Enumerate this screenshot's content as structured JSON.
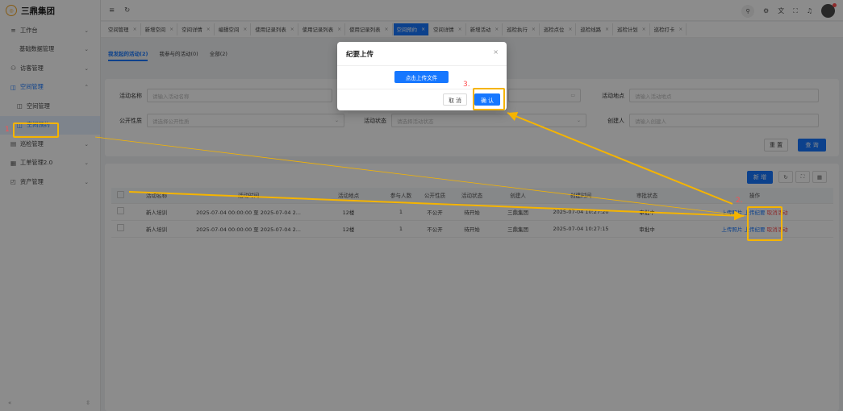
{
  "app": {
    "logo_text": "三鼎集团",
    "logo_glyph": "◎"
  },
  "sidebar": {
    "items": [
      {
        "label": "工作台",
        "icon": "≡"
      },
      {
        "label": "基础数据管理"
      },
      {
        "label": "访客管理",
        "icon": "⚇"
      },
      {
        "label": "空间管理",
        "icon": "◫"
      },
      {
        "label": "空间管理",
        "icon": "◫"
      },
      {
        "label": "空间预约",
        "icon": "◫"
      },
      {
        "label": "巡检管理",
        "icon": "▤"
      },
      {
        "label": "工单管理2.0",
        "icon": "▦"
      },
      {
        "label": "资产管理",
        "icon": "◰"
      }
    ],
    "collapse_glyph": "«",
    "bottom_glyph": "⇳"
  },
  "topbar": {
    "menu_glyph": "≡",
    "refresh_glyph": "↻",
    "right_icons": [
      "⚲",
      "⚙",
      "文",
      "⛶",
      "♫"
    ]
  },
  "tabs": [
    "空间管理",
    "新增空间",
    "空间详情",
    "编辑空间",
    "使用记录列表",
    "使用记录列表",
    "使用记录列表",
    "空间预约",
    "空间详情",
    "新增活动",
    "巡检执行",
    "巡检点位",
    "巡检线路",
    "巡检计划",
    "巡检打卡"
  ],
  "tab_close": "×",
  "subtabs": [
    "我发起的活动(2)",
    "我参与的活动(0)",
    "全部(2)"
  ],
  "form": {
    "fields": [
      {
        "label": "活动名称",
        "placeholder": "请输入活动名称"
      },
      {
        "label": "活动地点",
        "placeholder": "请输入活动地点"
      },
      {
        "label": "公开性质",
        "placeholder": "请选择公开性质"
      },
      {
        "label": "活动状态",
        "placeholder": "请选择活动状态"
      },
      {
        "label": "创建人",
        "placeholder": "请输入创建人"
      }
    ],
    "date_placeholder": "",
    "reset_label": "重 置",
    "search_label": "查 询"
  },
  "table": {
    "new_label": "新 增",
    "headers": [
      "活动名称",
      "活动时间",
      "活动地点",
      "参与人数",
      "公开性质",
      "活动状态",
      "创建人",
      "创建时间",
      "审批状态",
      "操作"
    ],
    "rows": [
      {
        "name": "新人培训",
        "time": "2025-07-04 00:00:00 至 2025-07-04 2...",
        "place": "12楼",
        "count": "1",
        "open": "不公开",
        "status": "待开始",
        "creator": "三鼎集团",
        "created": "2025-07-04 10:27:20",
        "approval": "审批中",
        "op1": "上传照片",
        "op2": "上传纪要",
        "op3": "取消活动"
      },
      {
        "name": "新人培训",
        "time": "2025-07-04 00:00:00 至 2025-07-04 2...",
        "place": "12楼",
        "count": "1",
        "open": "不公开",
        "status": "待开始",
        "creator": "三鼎集团",
        "created": "2025-07-04 10:27:15",
        "approval": "审批中",
        "op1": "上传照片",
        "op2": "上传纪要",
        "op3": "取消活动"
      }
    ]
  },
  "modal": {
    "title": "纪要上传",
    "upload_label": "点击上传文件",
    "cancel_label": "取 消",
    "confirm_label": "确 认",
    "close_glyph": "×"
  },
  "annotations": {
    "step1": "1.",
    "step2": "2.",
    "step3": "3.",
    "color": "#f5b400",
    "number_color": "#ff4d4f"
  }
}
